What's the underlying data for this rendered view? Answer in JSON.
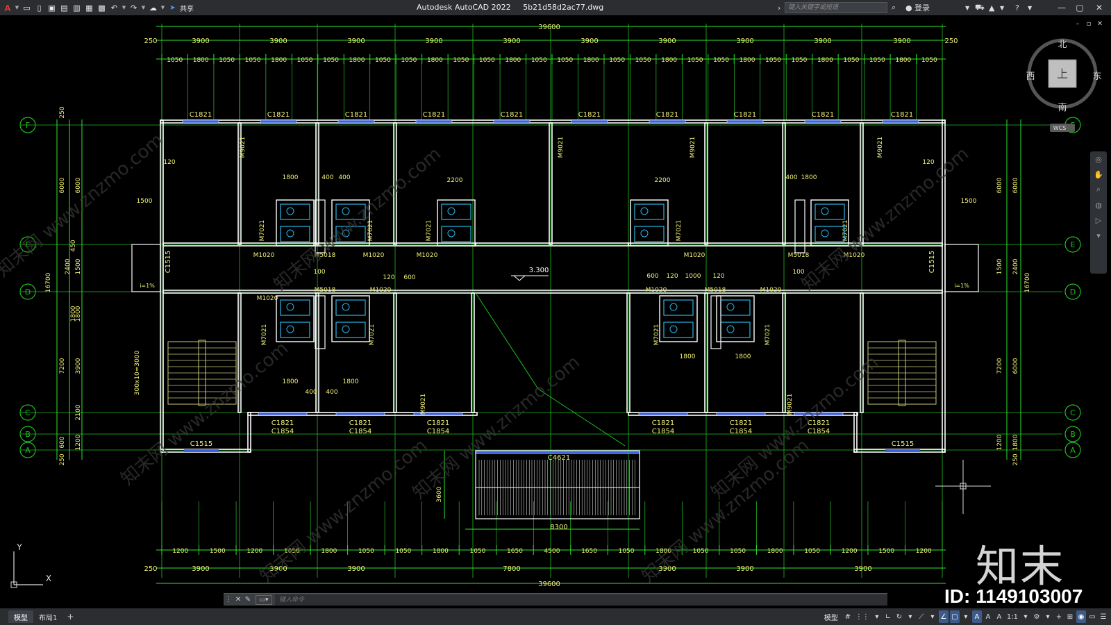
{
  "titlebar": {
    "app_logo": "A",
    "share_label": "共享",
    "app_name": "Autodesk AutoCAD 2022",
    "file_name": "5b21d58d2ac77.dwg",
    "search_placeholder": "键入关键字或短语",
    "login_label": "登录",
    "icons": [
      "new-icon",
      "open-icon",
      "save-icon",
      "saveas-icon",
      "cloud-save-icon",
      "plot-preview-icon",
      "print-icon",
      "undo-icon",
      "redo-icon",
      "web-mobile-icon",
      "share-icon"
    ]
  },
  "viewcube": {
    "north": "北",
    "south": "南",
    "east": "东",
    "west": "西",
    "face": "上",
    "ucs": "WCS"
  },
  "drawing": {
    "colors": {
      "background": "#000000",
      "axis_line": "#1fbf1f",
      "dimension": "#2ee62e",
      "wall": "#ffffff",
      "window": "#3a5fe0",
      "text": "#f2f27a",
      "fixture": "#29b6e6",
      "stair": "#c8c87a"
    },
    "top_total": "39600",
    "top_bays": [
      "3900",
      "3900",
      "3900",
      "3900",
      "3900",
      "3900",
      "3900",
      "3900",
      "3900",
      "3900"
    ],
    "top_edge": "250",
    "top_sub": [
      "1050",
      "1800",
      "1050",
      "1050",
      "1800",
      "1050",
      "1050",
      "1800",
      "1050",
      "1050",
      "1800",
      "1050",
      "1050",
      "1800",
      "1050",
      "1050",
      "1800",
      "1050",
      "1050",
      "1800",
      "1050",
      "1050",
      "1800",
      "1050",
      "1050",
      "1800",
      "1050",
      "1050",
      "1800",
      "1050"
    ],
    "bottom_sub": [
      "1200",
      "1500",
      "1200",
      "1050",
      "1800",
      "1050",
      "1050",
      "1800",
      "1050",
      "1650",
      "4500",
      "1650",
      "1050",
      "1800",
      "1050",
      "1050",
      "1800",
      "1050",
      "1200",
      "1500",
      "1200"
    ],
    "bottom_bays": [
      "3900",
      "3900",
      "3900",
      "7800",
      "3900",
      "3900",
      "3900"
    ],
    "bottom_total": "39600",
    "axis_left": [
      "F",
      "E",
      "D",
      "C",
      "B",
      "A"
    ],
    "axis_right": [
      "F",
      "E",
      "D",
      "C",
      "B",
      "A"
    ],
    "left_dims": [
      "250",
      "6000",
      "6000",
      "2400",
      "1500",
      "450",
      "16700",
      "1800",
      "3900",
      "7200",
      "2100",
      "600",
      "1200",
      "250",
      "1800"
    ],
    "right_dims": [
      "6000",
      "6000",
      "2400",
      "1500",
      "16700",
      "7200",
      "6000",
      "1200",
      "1800",
      "250"
    ],
    "window_labels_top": [
      "C1821",
      "C1821",
      "C1821",
      "C1821",
      "C1821",
      "C1821",
      "C1821",
      "C1821",
      "C1821",
      "C1821"
    ],
    "window_labels_bottom_a": [
      "C1821",
      "C1821",
      "C1821",
      "C1821",
      "C1821",
      "C1821"
    ],
    "window_labels_bottom_b": [
      "C1854",
      "C1854",
      "C1854",
      "C1854",
      "C1854",
      "C1854"
    ],
    "stair_window": "C1515",
    "entry_window": "C4621",
    "doors": [
      "M9021",
      "M7021",
      "M1020",
      "M5018",
      "M1020"
    ],
    "level_mark": "3.300",
    "ramp_slope": "i=1%",
    "stair_dim": "300x10=3000",
    "entry_width": "8300",
    "entry_depth": "3600",
    "misc_dims": [
      "1800",
      "400",
      "400",
      "2200",
      "1500",
      "120",
      "120",
      "600",
      "1000",
      "100",
      "150"
    ]
  },
  "commandline": {
    "placeholder": "键入命令"
  },
  "statusbar": {
    "tabs": [
      "模型",
      "布局1"
    ],
    "model_label": "模型",
    "scale": "1:1"
  },
  "watermark": {
    "logo": "知末",
    "id_text": "ID: 1149103007",
    "diagonal": "知末网 www.znzmo.com"
  }
}
